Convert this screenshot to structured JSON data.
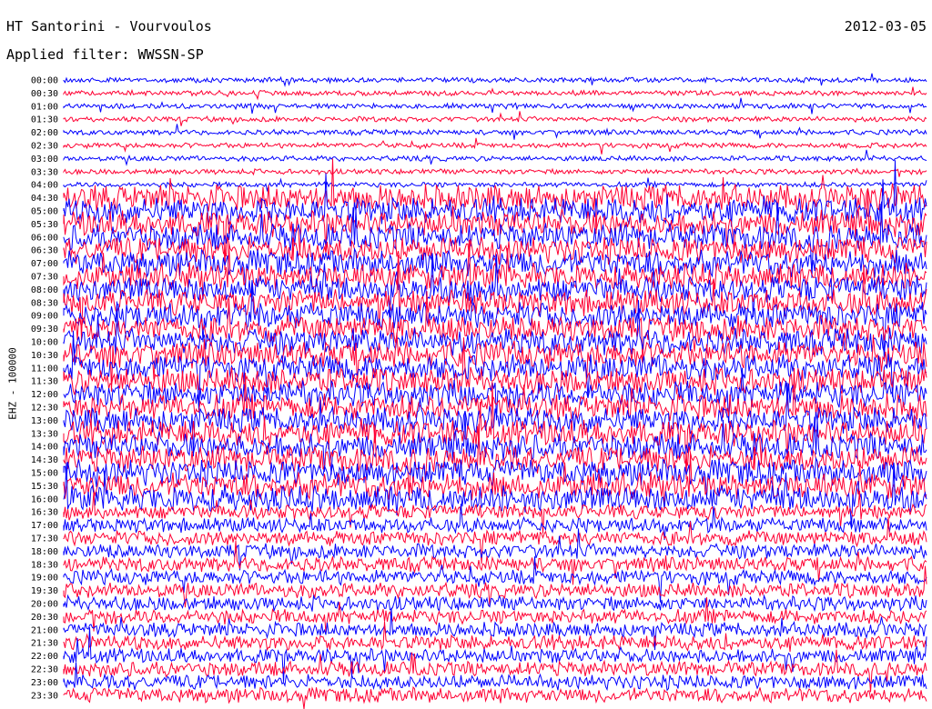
{
  "header": {
    "station_title": "HT Santorini - Vourvoulos",
    "filter_text": "Applied filter: WWSSN-SP",
    "date_text": "2012-03-05"
  },
  "chart_data": {
    "type": "line",
    "title": "HT Santorini - Vourvoulos",
    "subtitle": "Applied filter: WWSSN-SP",
    "ylabel": "EHZ - 100000",
    "trace_colors": [
      "#0000ff",
      "#ff0033"
    ],
    "traces": [
      {
        "time": "00:00",
        "color": "#0000ff",
        "activity": "quiet"
      },
      {
        "time": "00:30",
        "color": "#ff0033",
        "activity": "quiet"
      },
      {
        "time": "01:00",
        "color": "#0000ff",
        "activity": "quiet"
      },
      {
        "time": "01:30",
        "color": "#ff0033",
        "activity": "quiet"
      },
      {
        "time": "02:00",
        "color": "#0000ff",
        "activity": "quiet"
      },
      {
        "time": "02:30",
        "color": "#ff0033",
        "activity": "quiet"
      },
      {
        "time": "03:00",
        "color": "#0000ff",
        "activity": "quiet"
      },
      {
        "time": "03:30",
        "color": "#ff0033",
        "activity": "quiet"
      },
      {
        "time": "04:00",
        "color": "#0000ff",
        "activity": "quiet"
      },
      {
        "time": "04:30",
        "color": "#ff0033",
        "activity": "high"
      },
      {
        "time": "05:00",
        "color": "#0000ff",
        "activity": "high"
      },
      {
        "time": "05:30",
        "color": "#ff0033",
        "activity": "high"
      },
      {
        "time": "06:00",
        "color": "#0000ff",
        "activity": "high"
      },
      {
        "time": "06:30",
        "color": "#ff0033",
        "activity": "high"
      },
      {
        "time": "07:00",
        "color": "#0000ff",
        "activity": "high"
      },
      {
        "time": "07:30",
        "color": "#ff0033",
        "activity": "high"
      },
      {
        "time": "08:00",
        "color": "#0000ff",
        "activity": "high"
      },
      {
        "time": "08:30",
        "color": "#ff0033",
        "activity": "high"
      },
      {
        "time": "09:00",
        "color": "#0000ff",
        "activity": "high"
      },
      {
        "time": "09:30",
        "color": "#ff0033",
        "activity": "high"
      },
      {
        "time": "10:00",
        "color": "#0000ff",
        "activity": "high"
      },
      {
        "time": "10:30",
        "color": "#ff0033",
        "activity": "high"
      },
      {
        "time": "11:00",
        "color": "#0000ff",
        "activity": "high"
      },
      {
        "time": "11:30",
        "color": "#ff0033",
        "activity": "high"
      },
      {
        "time": "12:00",
        "color": "#0000ff",
        "activity": "high"
      },
      {
        "time": "12:30",
        "color": "#ff0033",
        "activity": "high"
      },
      {
        "time": "13:00",
        "color": "#0000ff",
        "activity": "high"
      },
      {
        "time": "13:30",
        "color": "#ff0033",
        "activity": "high"
      },
      {
        "time": "14:00",
        "color": "#0000ff",
        "activity": "high"
      },
      {
        "time": "14:30",
        "color": "#ff0033",
        "activity": "high"
      },
      {
        "time": "15:00",
        "color": "#0000ff",
        "activity": "high"
      },
      {
        "time": "15:30",
        "color": "#ff0033",
        "activity": "high"
      },
      {
        "time": "16:00",
        "color": "#0000ff",
        "activity": "high"
      },
      {
        "time": "16:30",
        "color": "#ff0033",
        "activity": "medium"
      },
      {
        "time": "17:00",
        "color": "#0000ff",
        "activity": "medium"
      },
      {
        "time": "17:30",
        "color": "#ff0033",
        "activity": "medium"
      },
      {
        "time": "18:00",
        "color": "#0000ff",
        "activity": "medium"
      },
      {
        "time": "18:30",
        "color": "#ff0033",
        "activity": "medium"
      },
      {
        "time": "19:00",
        "color": "#0000ff",
        "activity": "medium"
      },
      {
        "time": "19:30",
        "color": "#ff0033",
        "activity": "medium"
      },
      {
        "time": "20:00",
        "color": "#0000ff",
        "activity": "medium"
      },
      {
        "time": "20:30",
        "color": "#ff0033",
        "activity": "medium"
      },
      {
        "time": "21:00",
        "color": "#0000ff",
        "activity": "medium"
      },
      {
        "time": "21:30",
        "color": "#ff0033",
        "activity": "medium"
      },
      {
        "time": "22:00",
        "color": "#0000ff",
        "activity": "medium"
      },
      {
        "time": "22:30",
        "color": "#ff0033",
        "activity": "medium"
      },
      {
        "time": "23:00",
        "color": "#0000ff",
        "activity": "medium"
      },
      {
        "time": "23:30",
        "color": "#ff0033",
        "activity": "medium"
      }
    ]
  }
}
